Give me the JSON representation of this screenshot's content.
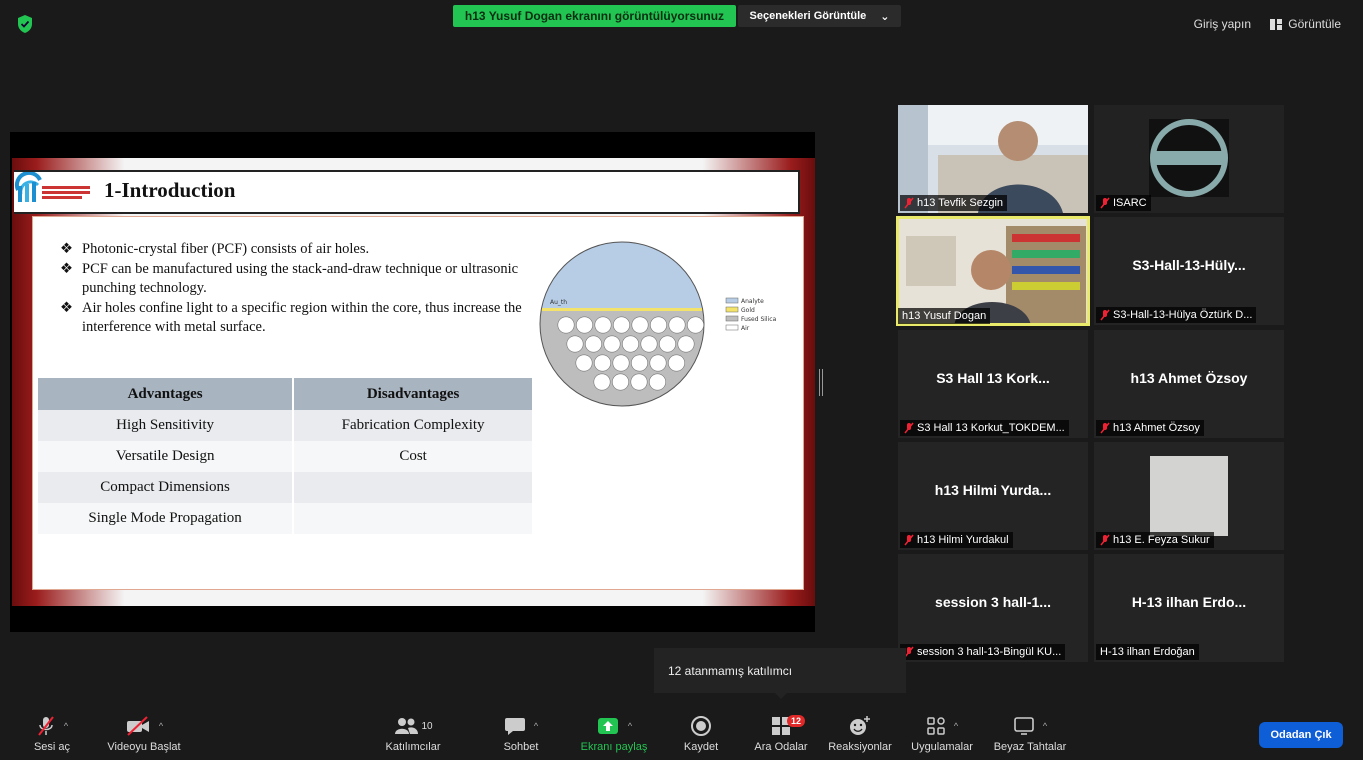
{
  "top_bar": {
    "share_banner": "h13 Yusuf Dogan ekranını görüntülüyorsunuz",
    "view_options": "Seçenekleri Görüntüle",
    "sign_in": "Giriş yapın",
    "view": "Görüntüle"
  },
  "slide": {
    "title": "1-Introduction",
    "bullets": [
      "Photonic-crystal fiber (PCF) consists of air holes.",
      "PCF can be manufactured using the stack-and-draw technique or ultrasonic punching technology.",
      "Air holes confine light to a specific region within the core, thus increase the interference with metal surface."
    ],
    "bullet_symbol": "❖",
    "diagram": {
      "label_top": "Au_th",
      "legend": [
        "Analyte",
        "Gold",
        "Fused Silica",
        "Air"
      ],
      "colors": {
        "analyte": "#b7cde6",
        "gold": "#f3e36b",
        "silica": "#bdbdbd",
        "air": "#ffffff"
      }
    },
    "table": {
      "headers": [
        "Advantages",
        "Disadvantages"
      ],
      "rows": [
        [
          "High Sensitivity",
          "Fabrication Complexity"
        ],
        [
          "Versatile Design",
          "Cost"
        ],
        [
          "Compact Dimensions",
          ""
        ],
        [
          "Single Mode Propagation",
          ""
        ]
      ]
    }
  },
  "participants": [
    {
      "name": "h13 Tevfik Sezgin",
      "video": true,
      "muted": true
    },
    {
      "name": "ISARC",
      "video": true,
      "muted": true
    },
    {
      "name": "h13 Yusuf Dogan",
      "video": true,
      "muted": false,
      "active": true
    },
    {
      "big": "S3-Hall-13-Hüly...",
      "name": "S3-Hall-13-Hülya Öztürk D...",
      "muted": true
    },
    {
      "big": "S3 Hall 13 Kork...",
      "name": "S3 Hall 13 Korkut_TOKDEM...",
      "muted": true
    },
    {
      "big": "h13 Ahmet Özsoy",
      "name": "h13 Ahmet Özsoy",
      "muted": true
    },
    {
      "big": "h13 Hilmi Yurda...",
      "name": "h13 Hilmi Yurdakul",
      "muted": true
    },
    {
      "name": "h13 E. Feyza Sukur",
      "video": true,
      "muted": true
    },
    {
      "big": "session 3 hall-1...",
      "name": "session 3 hall-13-Bingül KU...",
      "muted": true
    },
    {
      "big": "H-13 ilhan Erdo...",
      "name": "H-13 ilhan Erdoğan",
      "muted": false
    }
  ],
  "tooltip": "12 atanmamış katılımcı",
  "toolbar": {
    "mic": "Sesi aç",
    "video": "Videoyu Başlat",
    "participants": "Katılımcılar",
    "participants_count": "10",
    "chat": "Sohbet",
    "share": "Ekranı paylaş",
    "record": "Kaydet",
    "breakout": "Ara Odalar",
    "breakout_badge": "12",
    "reactions": "Reaksiyonlar",
    "apps": "Uygulamalar",
    "whiteboard": "Beyaz Tahtalar",
    "leave": "Odadan Çık"
  },
  "colors": {
    "share_green": "#23c552",
    "leave_blue": "#0e5ed8",
    "active_outline": "#eaea6a"
  }
}
